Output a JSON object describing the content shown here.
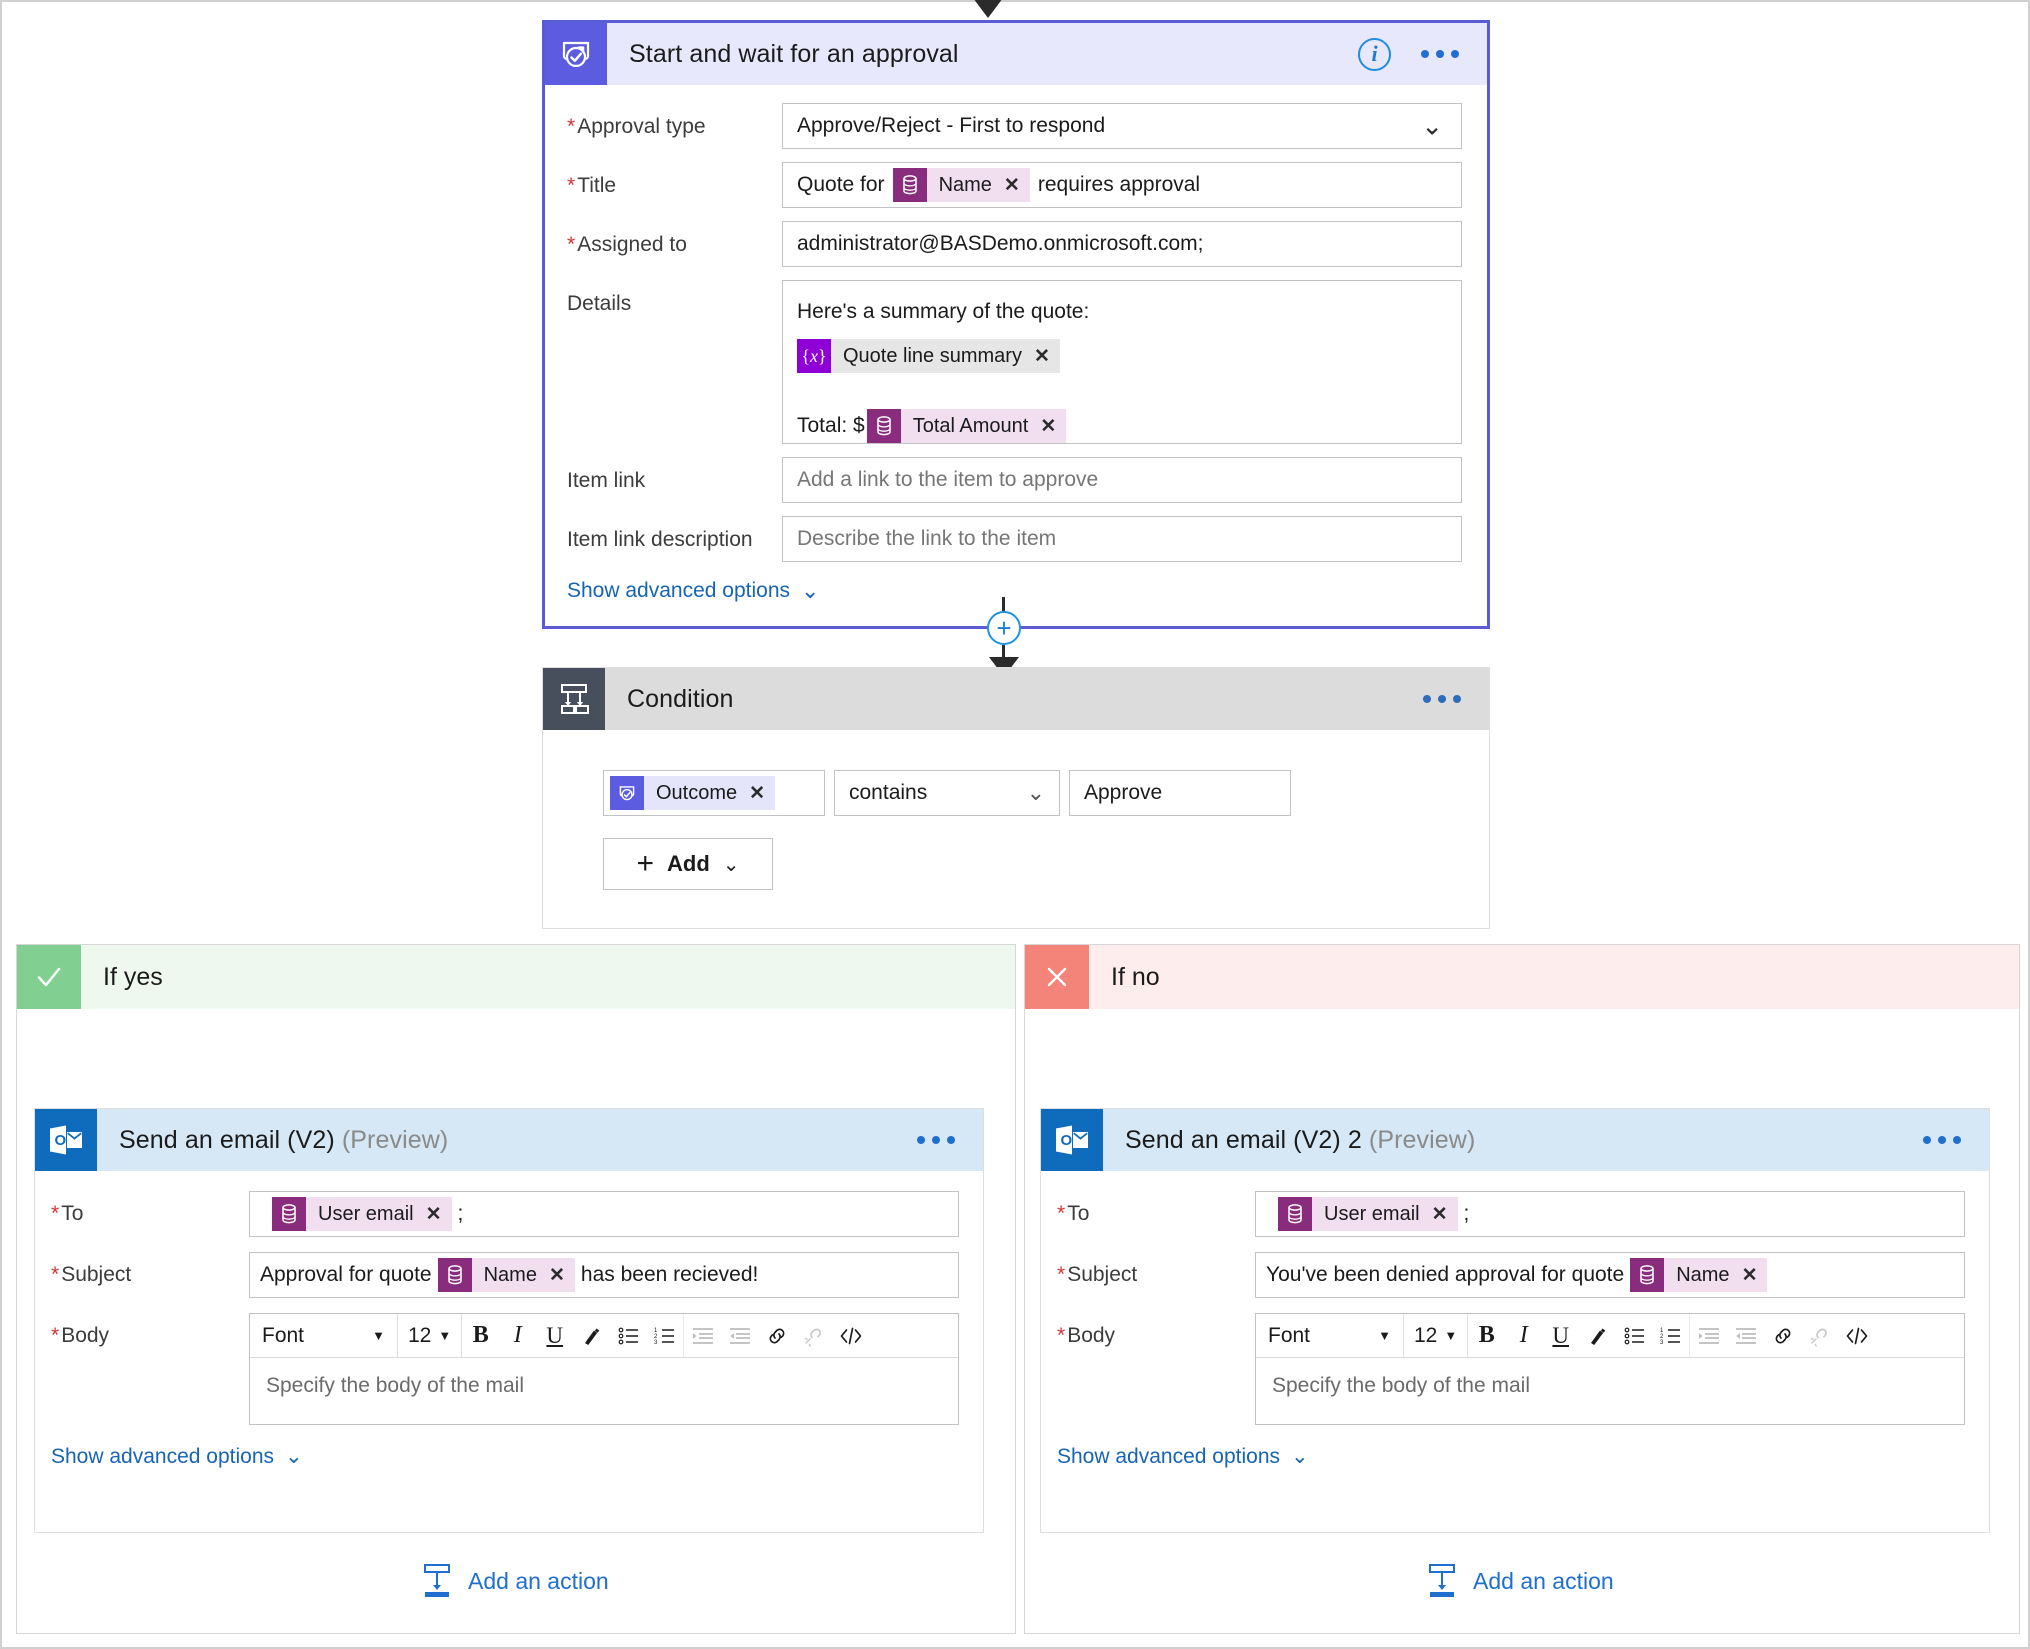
{
  "approval": {
    "title": "Start and wait for an approval",
    "icon": "approval-icon",
    "info_icon": "info-icon",
    "more_icon": "more-options-icon",
    "fields": {
      "approval_type": {
        "label": "Approval type",
        "required": true,
        "value": "Approve/Reject - First to respond"
      },
      "title": {
        "label": "Title",
        "required": true,
        "prefix": "Quote for",
        "token": "Name",
        "suffix": "requires approval"
      },
      "assigned_to": {
        "label": "Assigned to",
        "required": true,
        "value": "administrator@BASDemo.onmicrosoft.com;"
      },
      "details": {
        "label": "Details",
        "required": false,
        "line1": "Here's a summary of the quote:",
        "token_var": "Quote line summary",
        "line3_prefix": "Total: $",
        "token_db": "Total Amount"
      },
      "item_link": {
        "label": "Item link",
        "required": false,
        "placeholder": "Add a link to the item to approve"
      },
      "item_link_description": {
        "label": "Item link description",
        "required": false,
        "placeholder": "Describe the link to the item"
      }
    },
    "advanced_label": "Show advanced options"
  },
  "condition": {
    "title": "Condition",
    "icon": "condition-branch-icon",
    "more_icon": "more-options-icon",
    "row": {
      "token": "Outcome",
      "operator": "contains",
      "value": "Approve"
    },
    "add_label": "Add"
  },
  "branch_yes": {
    "label": "If yes",
    "icon": "checkmark-icon",
    "email": {
      "title": "Send an email (V2)",
      "preview_tag": "(Preview)",
      "icon": "outlook-icon",
      "more_icon": "more-options-icon",
      "to": {
        "label": "To",
        "required": true,
        "token": "User email",
        "suffix": ";"
      },
      "subject": {
        "label": "Subject",
        "required": true,
        "prefix": "Approval for quote",
        "token": "Name",
        "suffix": "has been recieved!"
      },
      "body": {
        "label": "Body",
        "required": true,
        "placeholder": "Specify the body of the mail"
      },
      "advanced_label": "Show advanced options"
    },
    "add_action_label": "Add an action"
  },
  "branch_no": {
    "label": "If no",
    "icon": "close-x-icon",
    "email": {
      "title": "Send an email (V2) 2",
      "preview_tag": "(Preview)",
      "icon": "outlook-icon",
      "more_icon": "more-options-icon",
      "to": {
        "label": "To",
        "required": true,
        "token": "User email",
        "suffix": ";"
      },
      "subject": {
        "label": "Subject",
        "required": true,
        "prefix": "You've been denied approval for quote",
        "token": "Name",
        "suffix": ""
      },
      "body": {
        "label": "Body",
        "required": true,
        "placeholder": "Specify the body of the mail"
      },
      "advanced_label": "Show advanced options"
    },
    "add_action_label": "Add an action"
  },
  "editor_toolbar": {
    "font_label": "Font",
    "size_label": "12",
    "buttons": [
      "bold-icon",
      "italic-icon",
      "underline-icon",
      "text-color-icon",
      "bulleted-list-icon",
      "numbered-list-icon",
      "indent-icon",
      "outdent-icon",
      "insert-link-icon",
      "remove-link-icon",
      "code-view-icon"
    ]
  },
  "colors": {
    "approval_accent": "#5c5ce0",
    "approval_header_bg": "#e8e8fc",
    "condition_icon_bg": "#464f5b",
    "condition_header_bg": "#dcdcdc",
    "outlook_blue": "#0f6cbd",
    "email_header_bg": "#d6e7f5",
    "yes_green": "#82d091",
    "no_red": "#f4837a",
    "token_db": "#8a2c7e",
    "token_var": "#8f00d6",
    "link_blue": "#1764b4",
    "required_red": "#d13438"
  }
}
